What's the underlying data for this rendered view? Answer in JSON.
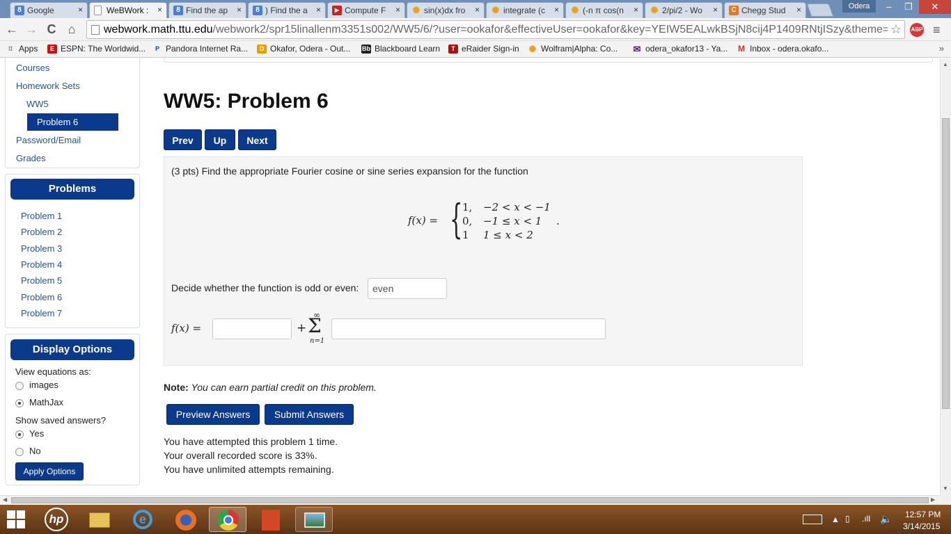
{
  "browser": {
    "tabs": [
      {
        "title": "Google",
        "icon": "8",
        "icon_color": "#4a7fd4"
      },
      {
        "title": "WeBWork :",
        "icon": "",
        "icon_color": "#ffffff",
        "active": true
      },
      {
        "title": "Find the ap",
        "icon": "8",
        "icon_color": "#4a7fd4"
      },
      {
        "title": ") Find the a",
        "icon": "8",
        "icon_color": "#4a7fd4"
      },
      {
        "title": "Compute F",
        "icon": "▶",
        "icon_color": "#cc2222"
      },
      {
        "title": "sin(x)dx fro",
        "icon": "✺",
        "icon_color": "#e8a020"
      },
      {
        "title": "integrate (c",
        "icon": "✺",
        "icon_color": "#e8a020"
      },
      {
        "title": "(-n π cos(n",
        "icon": "✺",
        "icon_color": "#e8a020"
      },
      {
        "title": "2/pi/2 - Wo",
        "icon": "✺",
        "icon_color": "#e8a020"
      },
      {
        "title": "Chegg Stud",
        "icon": "C",
        "icon_color": "#e87722"
      }
    ],
    "tab_close": "×",
    "profile": "Odera",
    "window_controls": {
      "minimize": "–",
      "restore": "❐",
      "close": "✕"
    },
    "nav": {
      "back": "←",
      "forward": "→",
      "reload": "C",
      "home": "⌂"
    },
    "url_host": "webwork.math.ttu.edu",
    "url_path": "/webwork2/spr15linallenm3351s002/WW5/6/?user=ookafor&effectiveUser=ookafor&key=YEIW5EALwkBSjN8cij4P1409RNtjISzy&theme=",
    "star": "☆",
    "abp": "ABP",
    "menu": "≡",
    "bookmarks": [
      {
        "label": "Apps",
        "icon": "⁞⁞",
        "color": "#555555"
      },
      {
        "label": "ESPN: The Worldwid...",
        "icon": "E",
        "color": "#cc1111"
      },
      {
        "label": "Pandora Internet Ra...",
        "icon": "P",
        "color": "#224488"
      },
      {
        "label": "Okafor, Odera - Out...",
        "icon": "O",
        "color": "#e8a000"
      },
      {
        "label": "Blackboard Learn",
        "icon": "Bb",
        "color": "#222222"
      },
      {
        "label": "eRaider Sign-in",
        "icon": "T",
        "color": "#aa1111"
      },
      {
        "label": "Wolfram|Alpha: Co...",
        "icon": "✺",
        "color": "#e8a020"
      },
      {
        "label": "odera_okafor13 - Ya...",
        "icon": "✉",
        "color": "#5a1a8a"
      },
      {
        "label": "Inbox - odera.okafo...",
        "icon": "M",
        "color": "#cc3333"
      }
    ],
    "bookmarks_more": "»"
  },
  "sidebar": {
    "links": [
      "Courses",
      "Homework Sets",
      "WW5"
    ],
    "active": "Problem 6",
    "links2": [
      "Password/Email",
      "Grades"
    ],
    "problems_header": "Problems",
    "problems": [
      "Problem 1",
      "Problem 2",
      "Problem 3",
      "Problem 4",
      "Problem 5",
      "Problem 6",
      "Problem 7"
    ],
    "display_header": "Display Options",
    "view_label": "View equations as:",
    "view_options": [
      "images",
      "MathJax"
    ],
    "view_selected": "MathJax",
    "saved_label": "Show saved answers?",
    "saved_options": [
      "Yes",
      "No"
    ],
    "saved_selected": "Yes",
    "apply": "Apply Options"
  },
  "main": {
    "title": "WW5: Problem 6",
    "nav": {
      "prev": "Prev",
      "up": "Up",
      "next": "Next"
    },
    "prompt": "(3 pts) Find the appropriate Fourier cosine or sine series expansion for the function",
    "function_lhs": "f(x) =",
    "cases": [
      {
        "value": "1,",
        "condition": "−2 < x < −1"
      },
      {
        "value": "0,",
        "condition": "−1 ≤ x < 1"
      },
      {
        "value": "1",
        "condition": "1 ≤ x < 2"
      }
    ],
    "period": ".",
    "odd_even_label": "Decide whether the function is odd or even:",
    "odd_even_value": "even",
    "series_lhs": "f(x) =",
    "series_plus": "+",
    "sum_symbol": "Σ",
    "sum_top": "∞",
    "sum_bottom": "n=1",
    "a0_value": "",
    "series_value": "",
    "note_bold": "Note:",
    "note_text": "You can earn partial credit on this problem.",
    "preview": "Preview Answers",
    "submit": "Submit Answers",
    "status": [
      "You have attempted this problem 1 time.",
      "Your overall recorded score is 33%.",
      "You have unlimited attempts remaining."
    ]
  },
  "taskbar": {
    "time": "12:57 PM",
    "date": "3/14/2015"
  }
}
